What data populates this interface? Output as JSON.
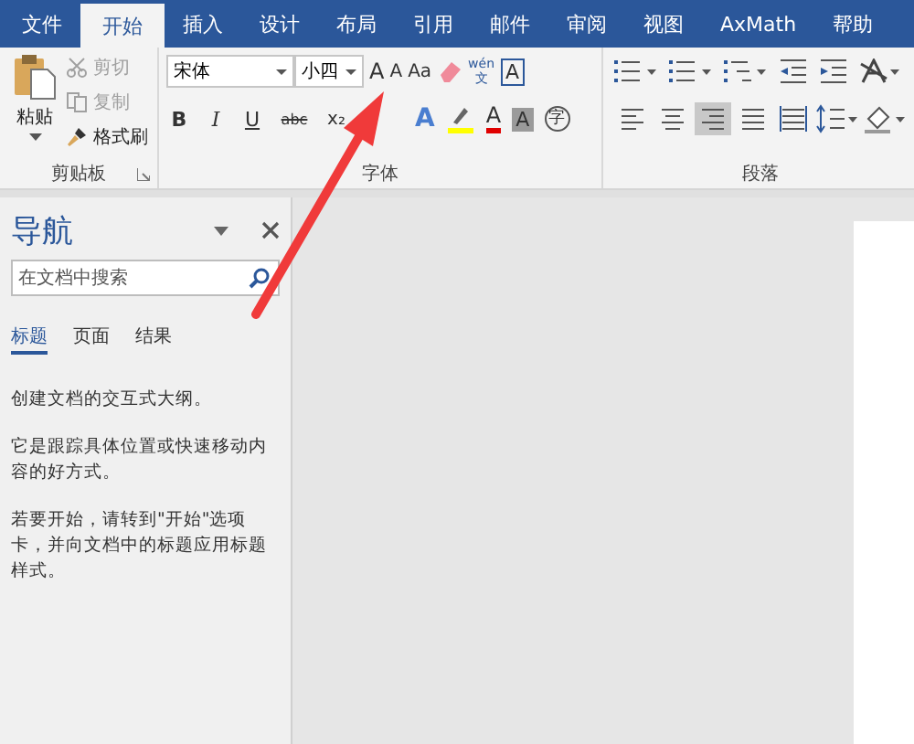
{
  "tabs": [
    {
      "label": "文件",
      "selected": false
    },
    {
      "label": "开始",
      "selected": true
    },
    {
      "label": "插入",
      "selected": false
    },
    {
      "label": "设计",
      "selected": false
    },
    {
      "label": "布局",
      "selected": false
    },
    {
      "label": "引用",
      "selected": false
    },
    {
      "label": "邮件",
      "selected": false
    },
    {
      "label": "审阅",
      "selected": false
    },
    {
      "label": "视图",
      "selected": false
    },
    {
      "label": "AxMath",
      "selected": false
    },
    {
      "label": "帮助",
      "selected": false
    }
  ],
  "clipboard": {
    "paste": "粘贴",
    "tools": [
      {
        "kind": "cut",
        "label": "剪切",
        "disabled": true
      },
      {
        "kind": "copy",
        "label": "复制",
        "disabled": true
      },
      {
        "kind": "painter",
        "label": "格式刷",
        "disabled": false
      }
    ],
    "group": "剪贴板"
  },
  "font": {
    "name": "宋体",
    "size": "小四",
    "row1": [
      {
        "kind": "grow",
        "label": "A"
      },
      {
        "kind": "shrink",
        "label": "A"
      },
      {
        "kind": "case",
        "label": "Aa"
      },
      {
        "kind": "clear"
      },
      {
        "kind": "phonetic",
        "label": "wén",
        "sub": "文"
      },
      {
        "kind": "border",
        "label": "A"
      }
    ],
    "row2": [
      {
        "kind": "bold",
        "label": "B"
      },
      {
        "kind": "italic",
        "label": "I"
      },
      {
        "kind": "underline",
        "label": "U"
      },
      {
        "kind": "strike",
        "label": "abc"
      },
      {
        "kind": "sub",
        "label": "x₂"
      },
      {
        "kind": "effect",
        "label": "A"
      },
      {
        "kind": "highlight"
      },
      {
        "kind": "color",
        "label": "A"
      },
      {
        "kind": "shade",
        "label": "A"
      },
      {
        "kind": "enclose",
        "label": "字"
      }
    ],
    "group": "字体"
  },
  "paragraph": {
    "row1": [
      {
        "kind": "bullets"
      },
      {
        "kind": "numbering"
      },
      {
        "kind": "multilevel"
      },
      {
        "kind": "outdent"
      },
      {
        "kind": "indent"
      },
      {
        "kind": "asian"
      }
    ],
    "aligns": [
      {
        "kind": "left",
        "selected": false
      },
      {
        "kind": "center",
        "selected": false
      },
      {
        "kind": "right",
        "selected": true
      },
      {
        "kind": "justify",
        "selected": false
      },
      {
        "kind": "distributed",
        "selected": false
      }
    ],
    "group": "段落"
  },
  "navigation": {
    "title": "导航",
    "search": {
      "placeholder": "在文档中搜索"
    },
    "tabs": [
      {
        "label": "标题",
        "selected": true
      },
      {
        "label": "页面",
        "selected": false
      },
      {
        "label": "结果",
        "selected": false
      }
    ],
    "paragraphs": [
      "创建文档的交互式大纲。",
      "它是跟踪具体位置或快速移动内容的好方式。",
      "若要开始，请转到\"开始\"选项卡，并向文档中的标题应用标题样式。"
    ]
  }
}
